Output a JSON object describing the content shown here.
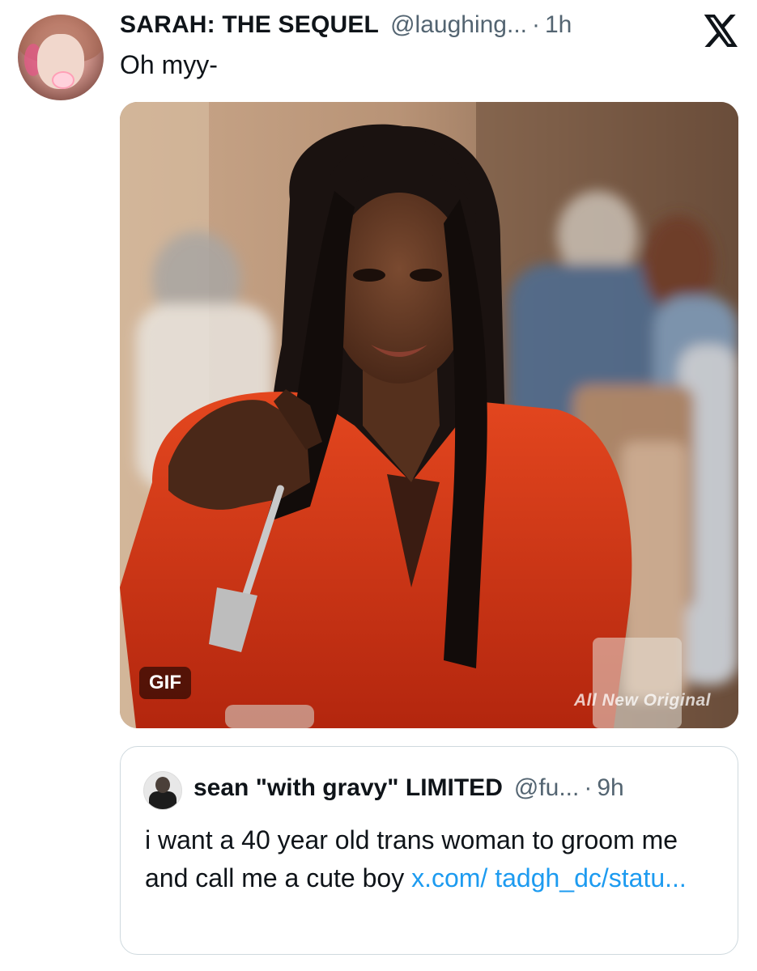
{
  "tweet": {
    "author_name": "SARAH: THE SEQUEL",
    "handle": "@laughing...",
    "separator": "·",
    "time": "1h",
    "text": "Oh myy-",
    "media": {
      "badge": "GIF",
      "watermark": "All New Original"
    }
  },
  "quoted_tweet": {
    "author_name": "sean \"with gravy\" LIMITED",
    "handle": "@fu...",
    "separator": "·",
    "time": "9h",
    "text": "i want a 40 year old trans woman to groom me and call me a cute boy ",
    "link_text": "x.com/ tadgh_dc/statu..."
  },
  "icons": {
    "brand_logo": "x-logo-icon"
  },
  "colors": {
    "text_primary": "#0f1419",
    "text_secondary": "#536471",
    "link": "#1d9bf0",
    "border": "#cfd9de"
  }
}
